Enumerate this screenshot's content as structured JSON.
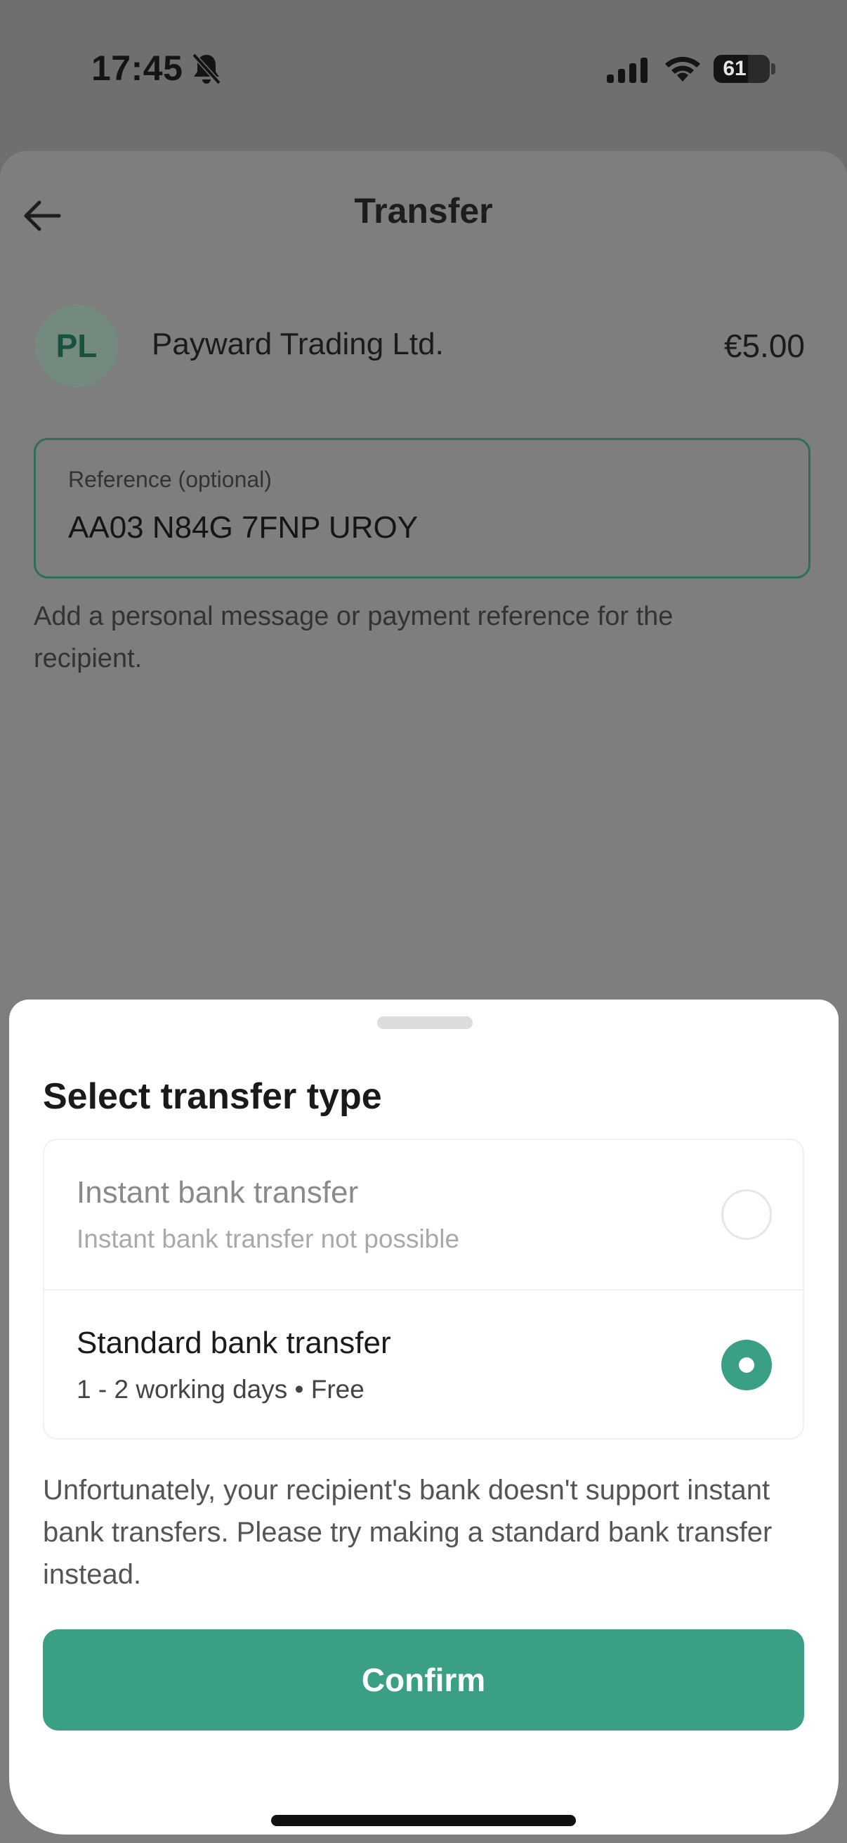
{
  "status_bar": {
    "time": "17:45",
    "battery_level": "61",
    "icons": [
      "bell-slash-icon",
      "cellular-signal-icon",
      "wifi-icon",
      "battery-icon"
    ]
  },
  "transfer": {
    "title": "Transfer",
    "back_icon": "arrow-left-icon",
    "recipient": {
      "initials": "PL",
      "name": "Payward Trading Ltd.",
      "amount": "€5.00"
    },
    "reference": {
      "label": "Reference (optional)",
      "value": "AA03 N84G 7FNP UROY"
    },
    "reference_help": "Add a personal message or payment reference for the recipient."
  },
  "sheet": {
    "title": "Select transfer type",
    "options": [
      {
        "title": "Instant bank transfer",
        "subtitle": "Instant bank transfer not possible",
        "selected": false,
        "enabled": false
      },
      {
        "title": "Standard bank transfer",
        "subtitle": "1 - 2 working days • Free",
        "selected": true,
        "enabled": true
      }
    ],
    "info": "Unfortunately, your recipient's bank doesn't support instant bank transfers. Please try making a standard bank transfer instead.",
    "confirm_label": "Confirm"
  },
  "colors": {
    "accent": "#3a9f85",
    "overlay": "#7e7e7e"
  }
}
